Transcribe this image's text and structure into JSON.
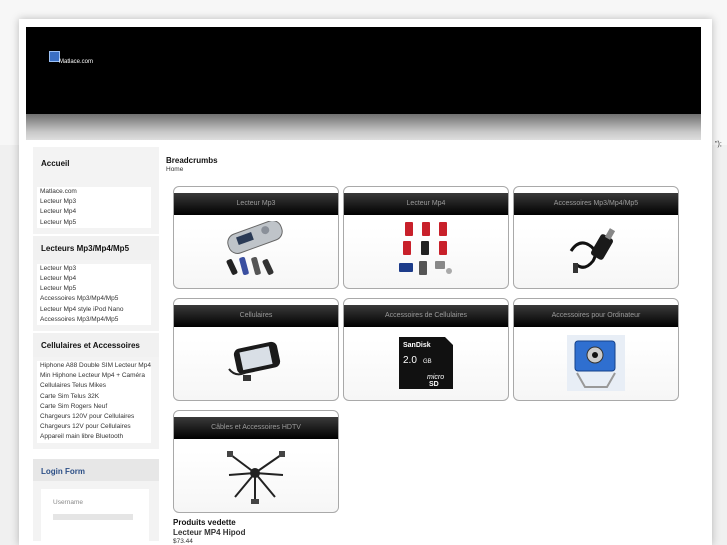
{
  "site": {
    "logo_text": "Matlace.com"
  },
  "stray_text": "\");",
  "sidebar": {
    "section1_title": "Accueil",
    "section1_items": [
      "Matlace.com",
      "Lecteur Mp3",
      "Lecteur Mp4",
      "Lecteur Mp5"
    ],
    "section2_title": "Lecteurs Mp3/Mp4/Mp5",
    "section2_items": [
      "Lecteur Mp3",
      "Lecteur Mp4",
      "Lecteur Mp5",
      "Accessoires Mp3/Mp4/Mp5",
      "Lecteur Mp4 style iPod Nano",
      "Accessoires Mp3/Mp4/Mp5"
    ],
    "section3_title": "Cellulaires et Accessoires",
    "section3_items": [
      "Hiphone A88 Double SIM Lecteur Mp4",
      "Min Hiphone Lecteur Mp4 + Caméra",
      "Cellulaires Telus Mikes",
      "Carte Sim Telus 32K",
      "Carte Sim Rogers Neuf",
      "Chargeurs 120V pour Cellulaires",
      "Chargeurs 12V pour Cellulaires",
      "Appareil main libre Bluetooth"
    ],
    "login_title": "Login Form",
    "username_label": "Username"
  },
  "breadcrumbs": {
    "title": "Breadcrumbs",
    "home": "Home"
  },
  "categories": [
    {
      "label": "Lecteur Mp3",
      "icon": "mp3-player-icon"
    },
    {
      "label": "Lecteur Mp4",
      "icon": "mp4-players-icon"
    },
    {
      "label": "Accessoires Mp3/Mp4/Mp5",
      "icon": "car-charger-icon"
    },
    {
      "label": "Cellulaires",
      "icon": "cellphone-icon"
    },
    {
      "label": "Accessoires de Cellulaires",
      "icon": "memory-card-icon"
    },
    {
      "label": "Accessoires pour Ordinateur",
      "icon": "webcam-icon"
    },
    {
      "label": "Câbles et Accessoires HDTV",
      "icon": "cable-icon"
    }
  ],
  "sd_card": {
    "brand": "SanDisk",
    "size": "2.0",
    "unit": "GB",
    "type": "microSD"
  },
  "featured": {
    "title": "Produits vedette",
    "product_name": "Lecteur MP4 Hipod",
    "price": "$73.44"
  }
}
